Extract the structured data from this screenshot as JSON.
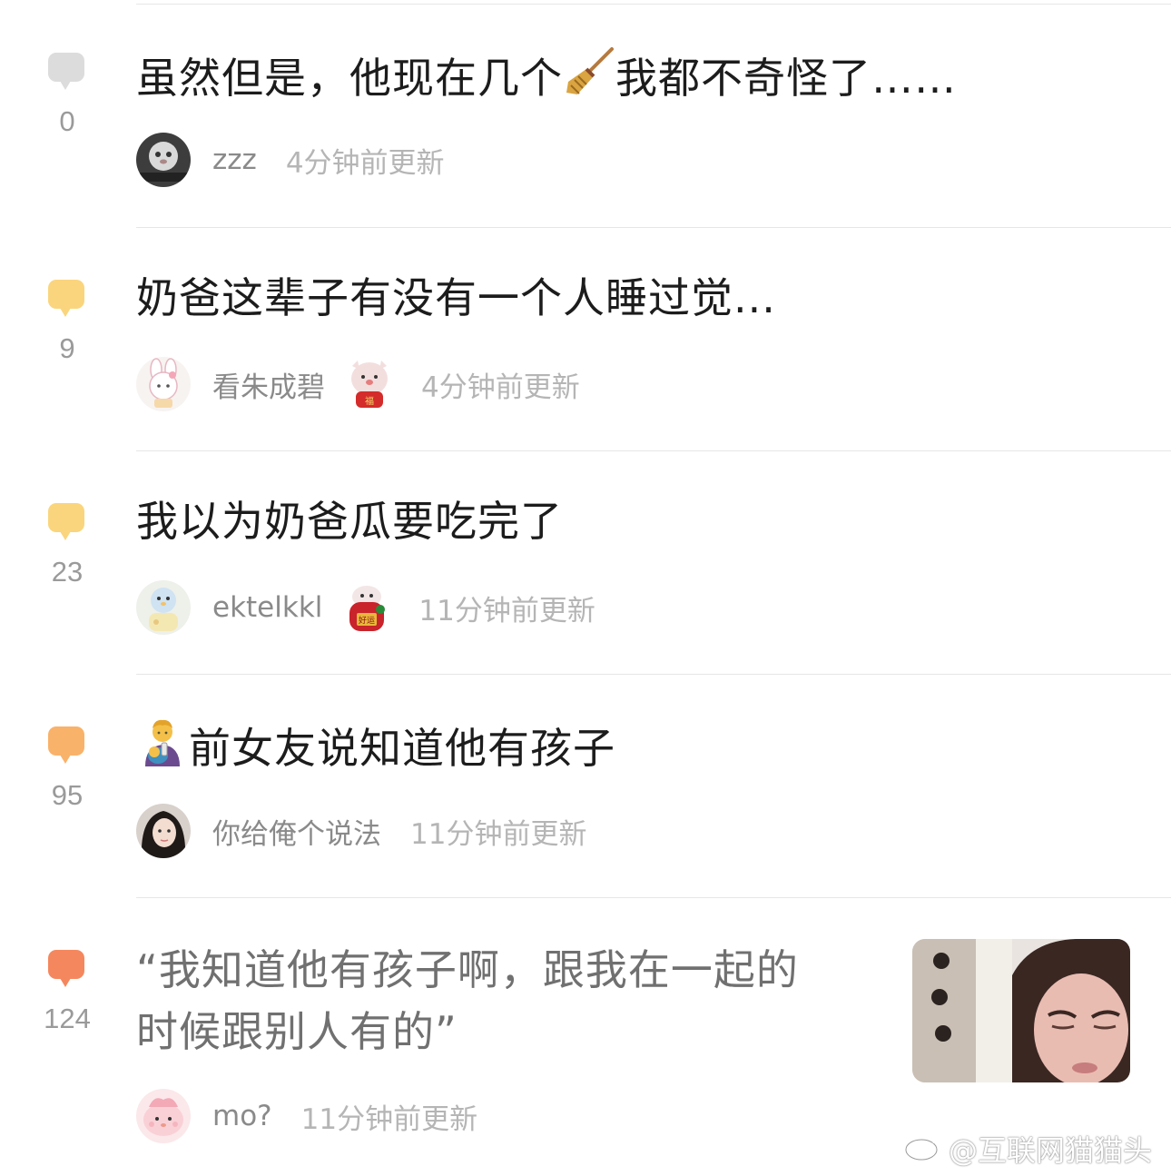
{
  "posts": [
    {
      "count": "0",
      "bubble_color": "#dcdcdc",
      "title": "虽然但是，他现在几个",
      "title_emoji": "broom-emoji",
      "title_suffix": "我都不奇怪了……",
      "author": "zzz",
      "time": "4分钟前更新"
    },
    {
      "count": "9",
      "bubble_color": "#fad57d",
      "title": "奶爸这辈子有没有一个人睡过觉...",
      "author": "看朱成碧",
      "time": "4分钟前更新"
    },
    {
      "count": "23",
      "bubble_color": "#fad57d",
      "title": "我以为奶爸瓜要吃完了",
      "author": "ektelkkl",
      "time": "11分钟前更新"
    },
    {
      "count": "95",
      "bubble_color": "#f9b26a",
      "title_emoji": "man-feeding-baby-emoji",
      "title": "前女友说知道他有孩子",
      "author": "你给俺个说法",
      "time": "11分钟前更新"
    },
    {
      "count": "124",
      "bubble_color": "#f5875e",
      "title_line1": "“我知道他有孩子啊，跟我在一起的",
      "title_line2": "时候跟别人有的”",
      "author": "mo?",
      "time": "11分钟前更新"
    }
  ],
  "watermark": {
    "text": "@互联网猫猫头"
  }
}
